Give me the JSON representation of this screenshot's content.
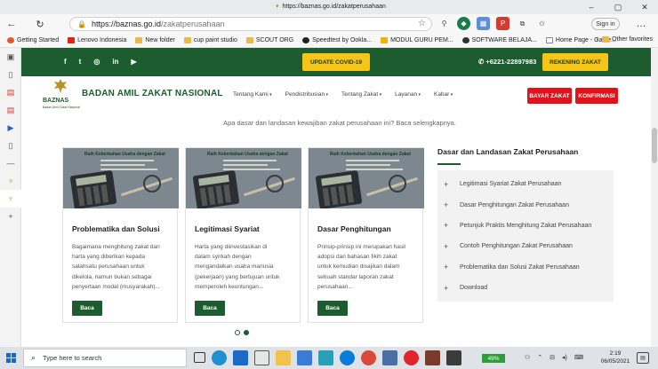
{
  "browser": {
    "window_title": "https://baznas.go.id/zakatperusahaan",
    "url_host": "https://baznas.go.id",
    "url_path": "/zakatperusahaan",
    "signin_label": "Sign in",
    "favorites": [
      {
        "label": "Getting Started",
        "color": "#e4572e"
      },
      {
        "label": "Lenovo Indonesia",
        "color": "#e2231a"
      },
      {
        "label": "New folder",
        "color": "#e8b84a"
      },
      {
        "label": "cup paint studio",
        "color": "#e8b84a"
      },
      {
        "label": "SCOUT ORG",
        "color": "#e8b84a"
      },
      {
        "label": "Speedtest by Ookla...",
        "color": "#222222"
      },
      {
        "label": "MODUL GURU PEM...",
        "color": "#f0b400"
      },
      {
        "label": "SOFTWARE BELAJA...",
        "color": "#333333"
      },
      {
        "label": "Home Page - Game...",
        "color": "#888888"
      }
    ],
    "other_favorites": "Other favorites",
    "extension_icons": [
      "puzzle-icon",
      "shield-icon",
      "grid-icon",
      "pdf-icon",
      "tab-icon",
      "star-collection-icon"
    ]
  },
  "site": {
    "topbar": {
      "social_icons": [
        "facebook-icon",
        "twitter-icon",
        "instagram-icon",
        "linkedin-icon",
        "youtube-icon"
      ],
      "covid_button": "UPDATE COVID-19",
      "phone": "+6221-22897983",
      "rekening_button": "REKENING ZAKAT"
    },
    "header": {
      "logo_text": "BAZNAS",
      "logo_subtitle": "Badan Amil Zakat Nasional",
      "org_name": "BADAN AMIL ZAKAT NASIONAL",
      "menu": [
        "Tentang Kami",
        "Pendistribusian",
        "Tentang Zakat",
        "Layanan",
        "Kabar"
      ],
      "bayar_button": "BAYAR ZAKAT",
      "konfirmasi_button": "KONFIRMASI"
    },
    "intro_text": "Apa dasar dan landasan kewajiban zakat perusahaan ini? Baca selengkapnya.",
    "card_image_caption": "Raih Keberkahan Usaha dengan Zakat",
    "cards": [
      {
        "title": "Problematika dan Solusi",
        "lines": [
          "Bagaimana menghitung zakat dari",
          "harta yang diberikan kepada",
          "salahsatu perusahaan untuk",
          "dikelola, namun bukan sebagai",
          "penyertaan modal (musyarakah)..."
        ],
        "button": "Baca"
      },
      {
        "title": "Legitimasi Syariat",
        "lines": [
          "Harta yang diinvestasikan di",
          "dalam syirkah dengan",
          "mengandalkan usaha manusia",
          "(pekerjaan) yang bertujuan untuk",
          "memperoleh keuntungan..."
        ],
        "button": "Baca"
      },
      {
        "title": "Dasar Penghitungan",
        "lines": [
          "Prinsip-prinsip ini merupakan hasil",
          "adopsi dari bahasan fikih zakat",
          "untuk kemudian disajikan dalam",
          "sebuah standar laporan zakat",
          "perusahaan..."
        ],
        "button": "Baca"
      }
    ],
    "carousel_dots": 2,
    "aside": {
      "title": "Dasar dan Landasan Zakat Perusahaan",
      "items": [
        "Legitimasi Syariat Zakat Perusahaan",
        "Dasar Penghitungan Zakat Perusahaan",
        "Petunjuk Praktis Menghitung Zakat Perusahaan",
        "Contoh Penghitungan Zakat Perusahaan",
        "Problematika dan Solusi Zakat Perusahaan",
        "Download"
      ]
    },
    "colors": {
      "brand_green": "#1d5c2e",
      "accent_yellow": "#f5c518",
      "red": "#e2111a"
    }
  },
  "taskbar": {
    "search_placeholder": "Type here to search",
    "battery": "49%",
    "time": "2:19",
    "date": "06/05/2021"
  }
}
